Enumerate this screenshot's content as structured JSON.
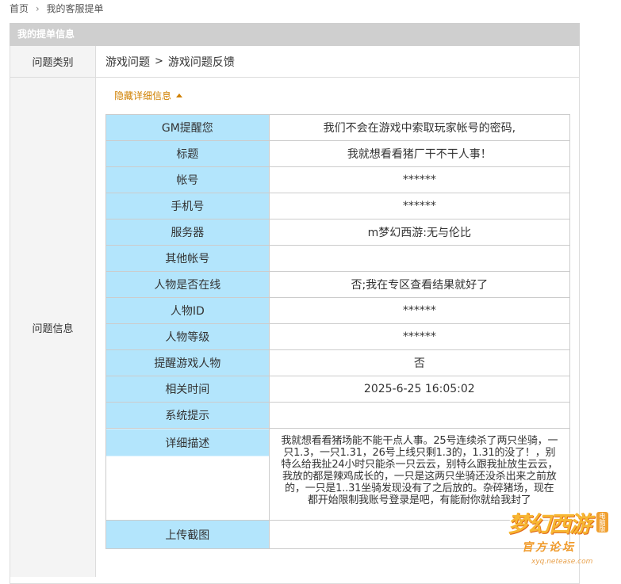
{
  "breadcrumb": {
    "home": "首页",
    "separator": "›",
    "current": "我的客服提单"
  },
  "panel": {
    "title": "我的提单信息"
  },
  "category": {
    "label": "问题类别",
    "level1": "游戏问题",
    "arrow": ">",
    "level2": "游戏问题反馈"
  },
  "info": {
    "label": "问题信息",
    "toggle_label": "隐藏详细信息",
    "rows": [
      {
        "key": "GM提醒您",
        "value": "我们不会在游戏中索取玩家帐号的密码,"
      },
      {
        "key": "标题",
        "value": "我就想看看猪厂干不干人事！"
      },
      {
        "key": "帐号",
        "value": "******"
      },
      {
        "key": "手机号",
        "value": "******"
      },
      {
        "key": "服务器",
        "value": "m梦幻西游:无与伦比"
      },
      {
        "key": "其他帐号",
        "value": ""
      },
      {
        "key": "人物是否在线",
        "value": "否;我在专区查看结果就好了"
      },
      {
        "key": "人物ID",
        "value": "******"
      },
      {
        "key": "人物等级",
        "value": "******"
      },
      {
        "key": "提醒游戏人物",
        "value": "否"
      },
      {
        "key": "相关时间",
        "value": "2025-6-25 16:05:02"
      },
      {
        "key": "系统提示",
        "value": ""
      }
    ],
    "description": {
      "key": "详细描述",
      "value": "我就想看看猪场能不能干点人事。25号连续杀了两只坐骑，一只1.3，一只1.31，26号上线只剩1.3的，1.31的没了！，别特么给我扯24小时只能杀一只云云，别特么跟我扯放生云云，我放的都是辣鸡成长的，一只是这两只坐骑还没杀出来之前放的，一只是1..31坐骑发现没有了之后放的。杂碎猪场，现在都开始限制我账号登录是吧，有能耐你就给我封了"
    },
    "upload": {
      "key": "上传截图",
      "value": ""
    }
  },
  "watermark": {
    "big": "梦幻西游",
    "small": "官方论坛",
    "url": "xyq.netease.com",
    "tag": "电脑版"
  },
  "colors": {
    "header_bg": "#cfcfcf",
    "key_cell_bg": "#b3e5fc",
    "toggle_link": "#d08000",
    "border": "#cccccc"
  }
}
